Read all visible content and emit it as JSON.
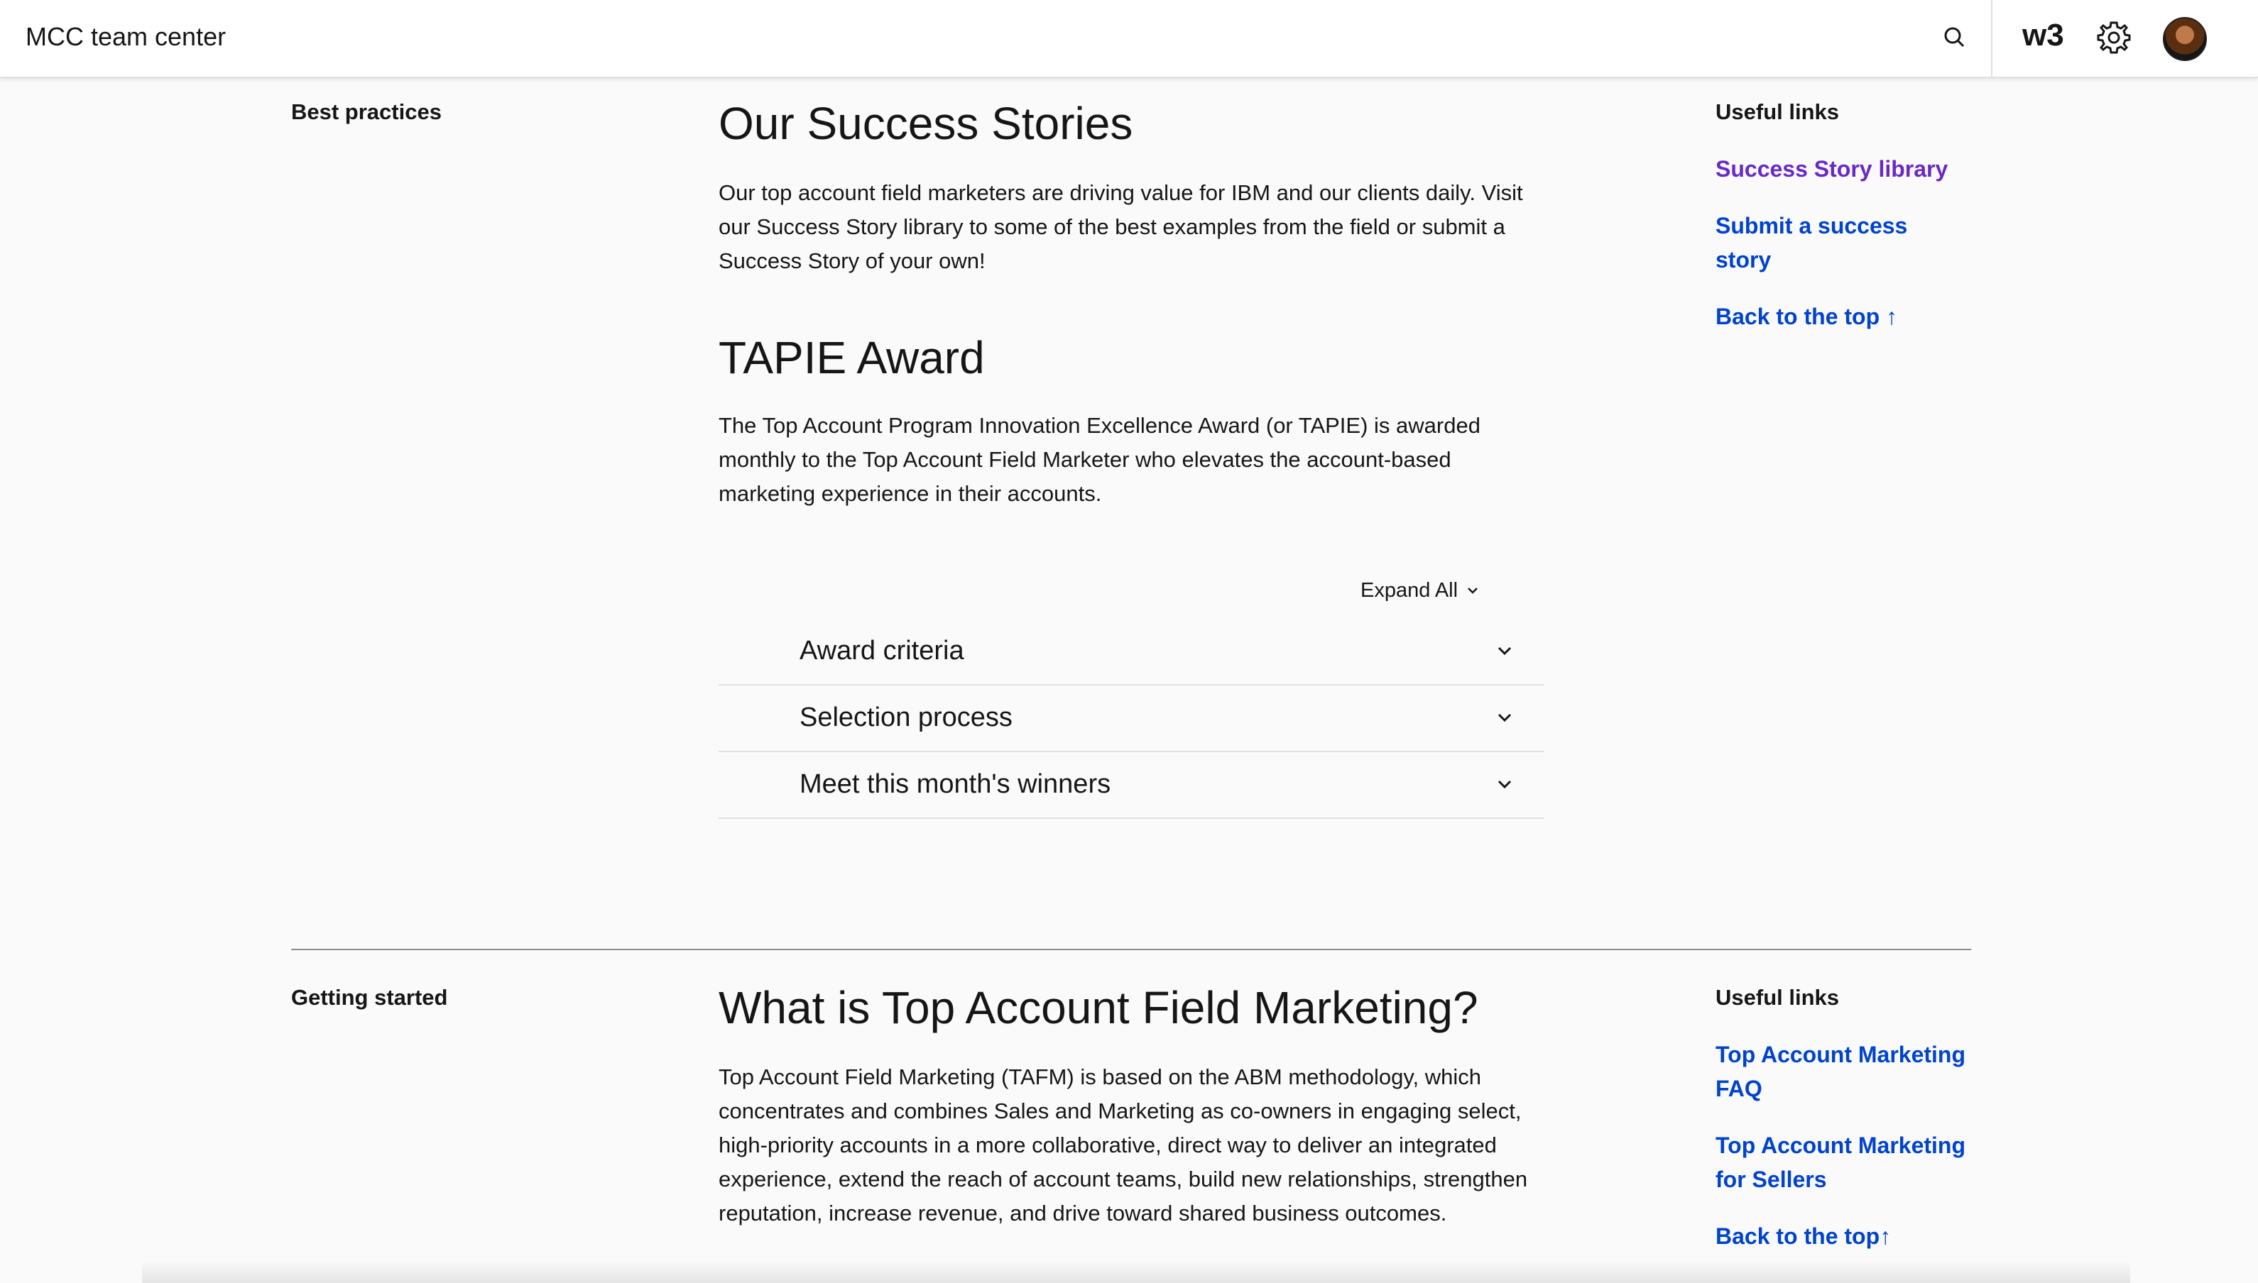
{
  "header": {
    "app_title": "MCC team center",
    "brand": "w3"
  },
  "sections": [
    {
      "side_heading": "Best practices",
      "blocks": [
        {
          "title": "Our Success Stories",
          "text": "Our top account field marketers are driving value for IBM and our clients daily. Visit our Success Story library to some of the best examples from the field or submit a Success Story of your own!"
        },
        {
          "title": "TAPIE Award",
          "text": "The Top Account Program Innovation Excellence Award (or TAPIE) is awarded monthly to the Top Account Field Marketer who elevates the account-based marketing experience in their accounts."
        }
      ],
      "expand_all": "Expand All",
      "accordion": [
        "Award criteria",
        "Selection process",
        "Meet this month's winners"
      ],
      "useful_links_heading": "Useful links",
      "links": [
        "Success Story library",
        "Submit a success story",
        "Back to the top ↑"
      ]
    },
    {
      "side_heading": "Getting started",
      "title": "What is Top Account Field Marketing?",
      "text": "Top Account Field Marketing (TAFM) is based on the ABM methodology, which concentrates and combines Sales and Marketing as co-owners in engaging select, high-priority accounts in a more collaborative, direct way to deliver an integrated experience, extend the reach of account teams, build new relationships, strengthen reputation, increase revenue, and drive toward shared business outcomes.",
      "useful_links_heading": "Useful links",
      "links": [
        "Top Account Marketing FAQ",
        "Top Account Marketing for Sellers",
        "Back to the top↑"
      ]
    }
  ],
  "colors": {
    "link": "#0043ce",
    "visited_link": "#6929c4",
    "text": "#161616",
    "background": "#fafafa"
  },
  "icons": [
    "search-icon",
    "gear-icon",
    "chevron-down-icon",
    "avatar"
  ]
}
